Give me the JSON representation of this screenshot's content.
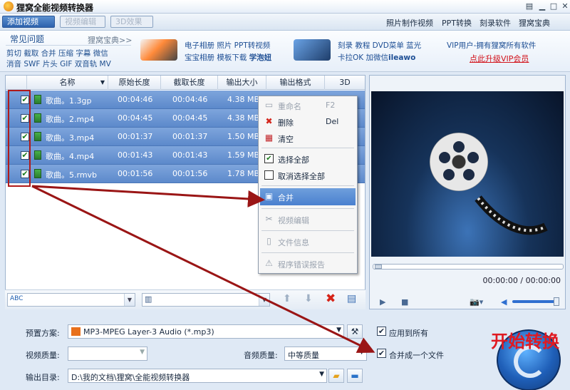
{
  "app": {
    "title": "狸窝全能视频转换器",
    "icon": "app-logo-icon"
  },
  "window_controls": [
    "menu-icon",
    "minimize-icon",
    "maximize-icon",
    "close-icon"
  ],
  "toolbar": {
    "add_video": "添加视频",
    "video_edit": "视频编辑",
    "effect_3d": "3D效果"
  },
  "top_links": [
    "照片制作视频",
    "PPT转换",
    "刻录软件",
    "狸窝宝典"
  ],
  "banner": {
    "faq_title": "常见问题",
    "faq_more": "狸窝宝典>>",
    "faq_line1": "剪切 截取 合并 压缩 字幕 微信",
    "faq_line2": "消音 SWF 片头 GIF 双音轨 MV",
    "promo1_line1": "电子相册 照片 PPT转视频",
    "promo1_line2": "宝宝相册 模板下载",
    "promo1_line2_strong": "学泡妞",
    "promo2_line1": "刻录 教程 DVD菜单 蓝光",
    "promo2_line2": "卡拉OK 加微信",
    "promo2_line2_strong": "ileawo",
    "vip_line": "VIP用户-拥有狸窝所有软件",
    "vip_link": "点此升级VIP会员"
  },
  "table": {
    "headers": [
      "名称",
      "原始长度",
      "截取长度",
      "输出大小",
      "输出格式",
      "3D"
    ],
    "rows": [
      {
        "name": "歌曲。1.3gp",
        "original": "00:04:46",
        "clip": "00:04:46",
        "size": "4.38 MB",
        "checked": true
      },
      {
        "name": "歌曲。2.mp4",
        "original": "00:04:45",
        "clip": "00:04:45",
        "size": "4.38 MB",
        "checked": true
      },
      {
        "name": "歌曲。3.mp4",
        "original": "00:01:37",
        "clip": "00:01:37",
        "size": "1.50 MB",
        "checked": true
      },
      {
        "name": "歌曲。4.mp4",
        "original": "00:01:43",
        "clip": "00:01:43",
        "size": "1.59 MB",
        "checked": true
      },
      {
        "name": "歌曲。5.rmvb",
        "original": "00:01:56",
        "clip": "00:01:56",
        "size": "1.78 MB",
        "checked": true
      }
    ]
  },
  "context_menu": {
    "rename": "重命名",
    "rename_key": "F2",
    "delete": "删除",
    "delete_key": "Del",
    "clear": "清空",
    "select_all": "选择全部",
    "deselect_all": "取消选择全部",
    "merge": "合并",
    "video_edit": "视频编辑",
    "file_info": "文件信息",
    "error_report": "程序错误报告"
  },
  "player": {
    "time": "00:00:00 / 00:00:00"
  },
  "settings": {
    "preset_label": "预置方案:",
    "preset_value": "MP3-MPEG Layer-3 Audio (*.mp3)",
    "apply_all": "应用到所有",
    "video_quality_label": "视频质量:",
    "video_quality_value": "",
    "audio_quality_label": "音频质量:",
    "audio_quality_value": "中等质量",
    "merge_one": "合并成一个文件",
    "output_label": "输出目录:",
    "output_value": "D:\\我的文档\\狸窝\\全能视频转换器"
  },
  "start": {
    "label": "开始转换"
  },
  "colors": {
    "accent_blue": "#2d62ad",
    "row_selected": "#5c89cb",
    "highlight_red": "#b01a1a",
    "start_red": "#e01a22"
  }
}
